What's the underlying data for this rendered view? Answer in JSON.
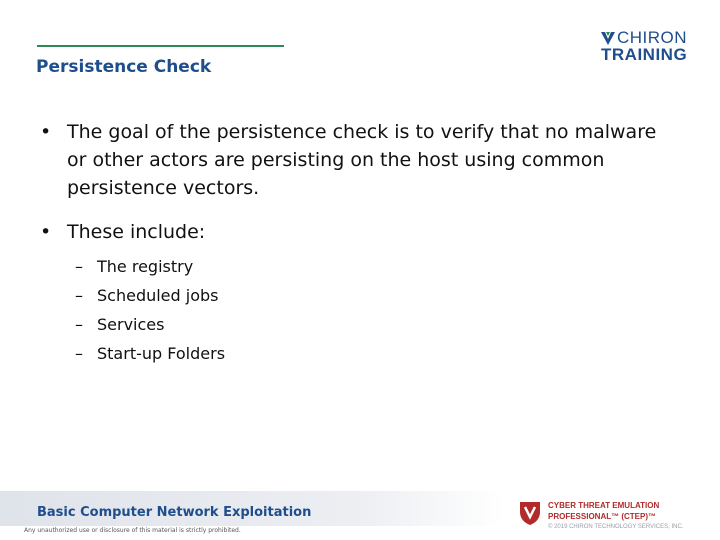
{
  "header": {
    "title": "Persistence Check",
    "logo": {
      "brand": "CHIRON",
      "sub": "TRAINING"
    }
  },
  "bullets": [
    {
      "text": "The goal of the persistence check is to verify that no malware or other actors are persisting on the host using common persistence vectors."
    },
    {
      "text": "These include:"
    }
  ],
  "subitems": [
    "The registry",
    "Scheduled jobs",
    "Services",
    "Start-up Folders"
  ],
  "footer": {
    "course": "Basic Computer Network Exploitation",
    "notice": "Any unauthorized use or disclosure of this material is strictly prohibited.",
    "program_line1": "CYBER THREAT EMULATION",
    "program_line2": "PROFESSIONAL™ (CTEP)™",
    "copyright": "© 2019 CHIRON TECHNOLOGY SERVICES, INC."
  },
  "colors": {
    "title": "#1f4e8c",
    "rule": "#2e8b57",
    "brand_red": "#b22a2a"
  },
  "icons": {
    "bullet": "•",
    "dash": "–"
  }
}
